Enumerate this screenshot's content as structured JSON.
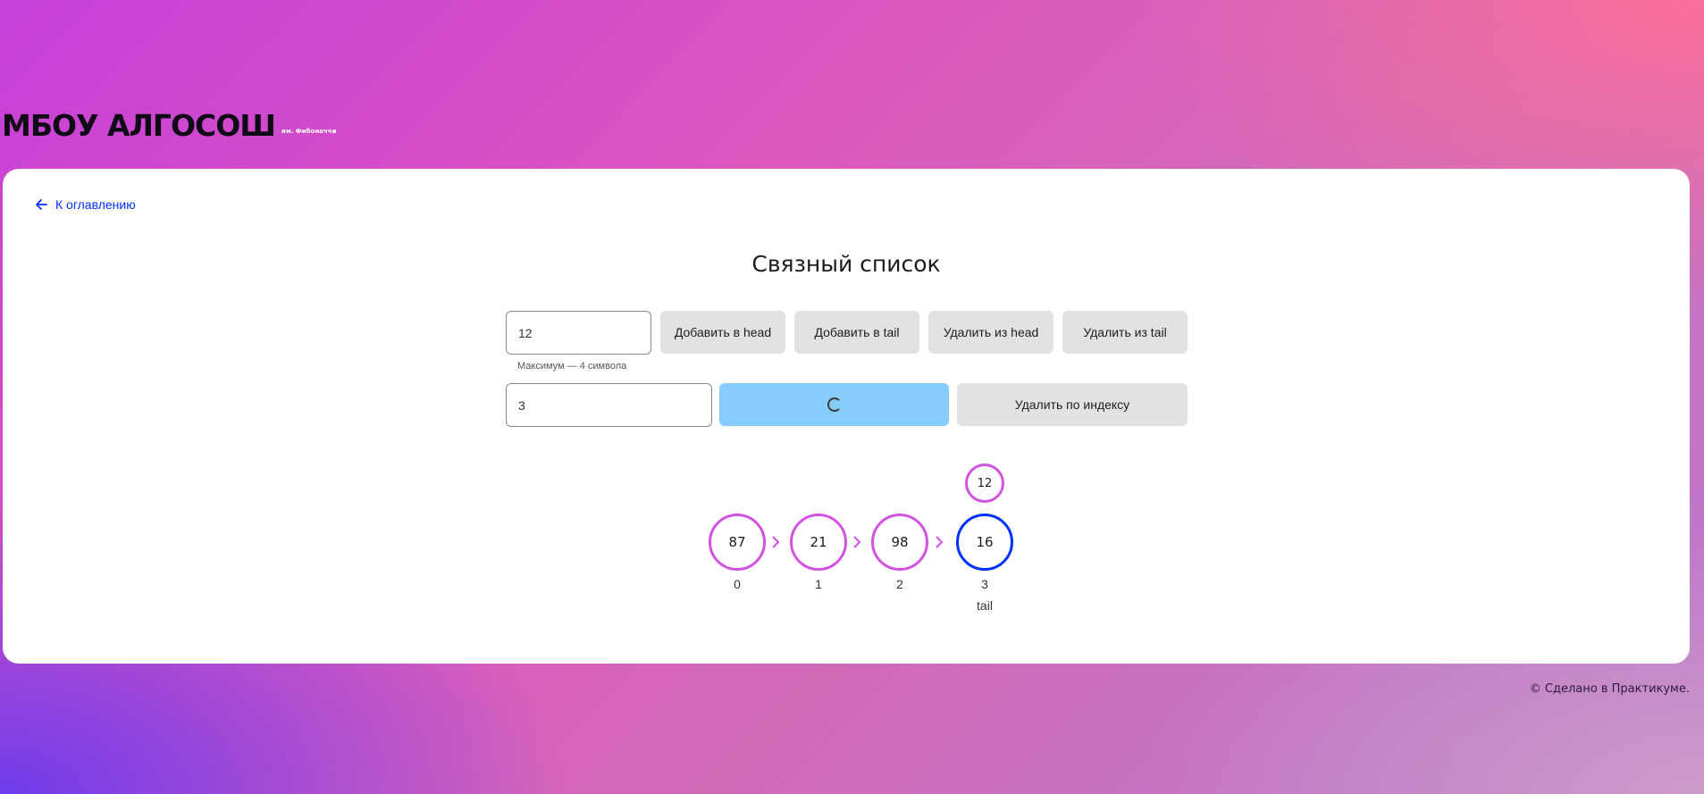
{
  "logo": {
    "title": "МБОУ АЛГОСОШ",
    "subtitle": "им. Фибоначчи"
  },
  "nav": {
    "back_label": "К оглавлению"
  },
  "page": {
    "title": "Связный список"
  },
  "controls": {
    "value_input": {
      "value": "12",
      "hint": "Максимум — 4 символа"
    },
    "add_head_label": "Добавить в head",
    "add_tail_label": "Добавить в tail",
    "remove_head_label": "Удалить из head",
    "remove_tail_label": "Удалить из tail",
    "index_input": {
      "value": "3"
    },
    "add_by_index": {
      "loading": true
    },
    "remove_by_index_label": "Удалить по индексу"
  },
  "list": {
    "nodes": [
      {
        "value": "87",
        "index": "0",
        "state": "default"
      },
      {
        "value": "21",
        "index": "1",
        "state": "default"
      },
      {
        "value": "98",
        "index": "2",
        "state": "default"
      },
      {
        "value": "16",
        "index": "3",
        "state": "changing",
        "tail_label": "tail",
        "pending_value": "12"
      }
    ]
  },
  "colors": {
    "default": "#d252e1",
    "changing": "#0032ff",
    "active_button": "#87cdfb"
  },
  "footer": {
    "text": "© Сделано в Практикуме."
  }
}
